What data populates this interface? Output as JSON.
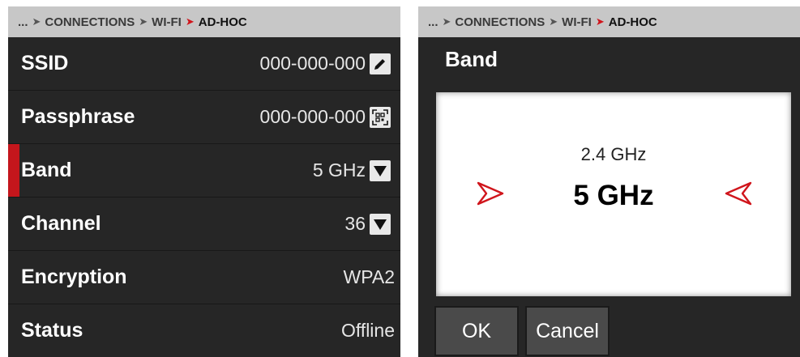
{
  "breadcrumb": {
    "root": "...",
    "items": [
      "CONNECTIONS",
      "WI-FI"
    ],
    "current": "AD-HOC"
  },
  "settings": {
    "rows": [
      {
        "label": "SSID",
        "value": "000-000-000",
        "icon": "pencil-icon"
      },
      {
        "label": "Passphrase",
        "value": "000-000-000",
        "icon": "qr-code-icon"
      },
      {
        "label": "Band",
        "value": "5 GHz",
        "icon": "dropdown-icon",
        "selected": true
      },
      {
        "label": "Channel",
        "value": "36",
        "icon": "dropdown-icon"
      },
      {
        "label": "Encryption",
        "value": "WPA2"
      },
      {
        "label": "Status",
        "value": "Offline"
      }
    ]
  },
  "dialog": {
    "title": "Band",
    "options": {
      "previous": "2.4 GHz",
      "selected": "5 GHz"
    },
    "ok_label": "OK",
    "cancel_label": "Cancel"
  },
  "colors": {
    "accent": "#d0151c",
    "panel": "#262626",
    "breadcrumb_bg": "#c7c7c7"
  }
}
